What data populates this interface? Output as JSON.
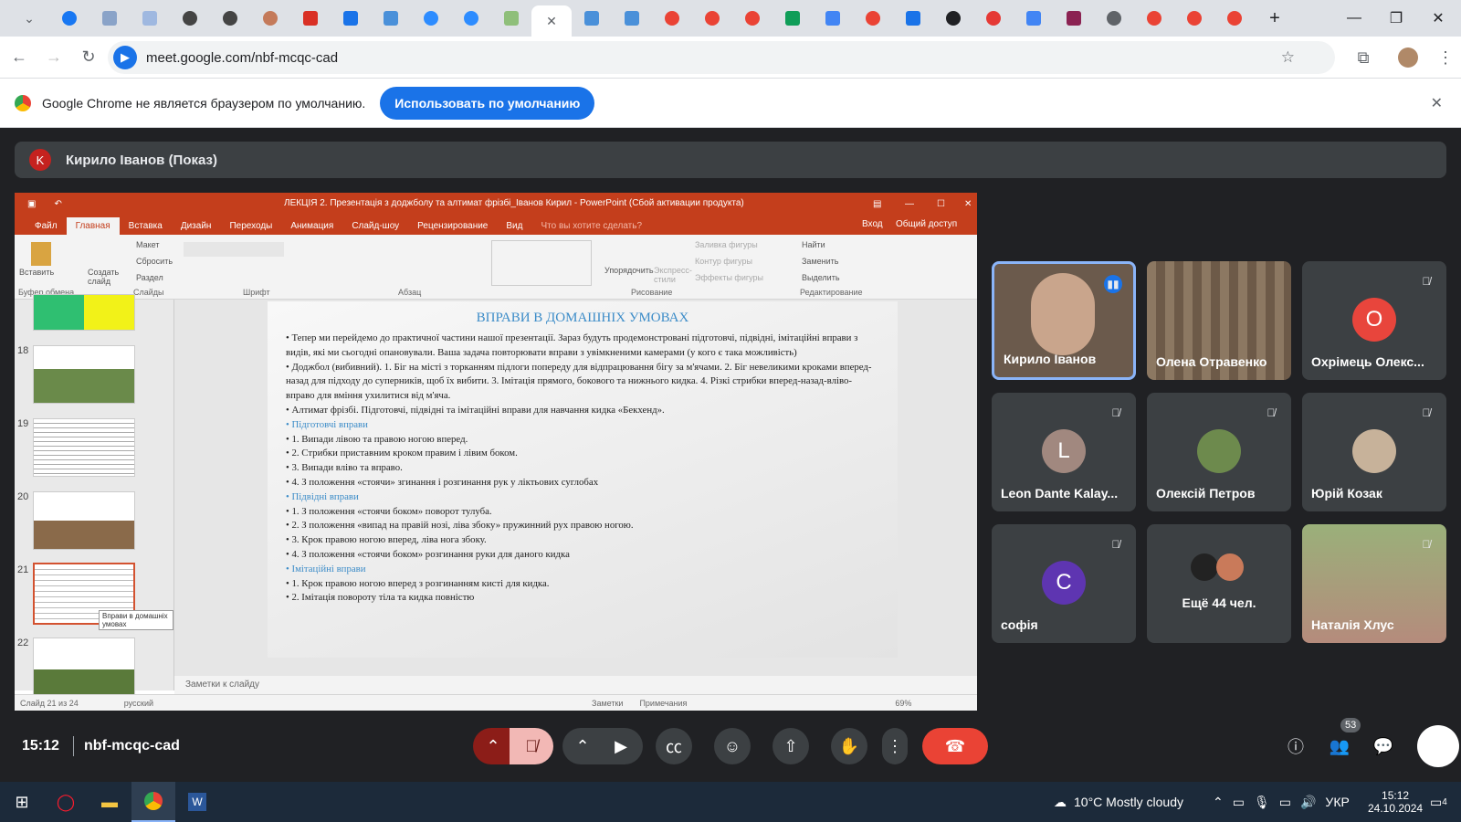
{
  "browser": {
    "tabs": [
      "facebook",
      "tab",
      "tab",
      "tab",
      "tab",
      "tab",
      "shield",
      "S",
      "tab",
      "zoom",
      "zoom",
      "tab",
      "active",
      "tab",
      "tab",
      "google",
      "google",
      "google",
      "tab",
      "translate",
      "google",
      "S",
      "24",
      "tab",
      "doc",
      "tab",
      "tab",
      "google",
      "google",
      "google"
    ],
    "new_tab_icon": "+",
    "url": "meet.google.com/nbf-mcqc-cad"
  },
  "infobar": {
    "message": "Google Chrome не является браузером по умолчанию.",
    "button": "Использовать по умолчанию",
    "close": "✕"
  },
  "presenter": {
    "avatar_letter": "K",
    "label": "Кирило Іванов (Показ)"
  },
  "powerpoint": {
    "title": "ЛЕКЦІЯ 2. Презентація з доджболу та алтимат фрізбі_Іванов Кирил - PowerPoint (Сбой активации продукта)",
    "tabs": [
      "Файл",
      "Главная",
      "Вставка",
      "Дизайн",
      "Переходы",
      "Анимация",
      "Слайд-шоу",
      "Рецензирование",
      "Вид",
      "Что вы хотите сделать?"
    ],
    "signin": "Вход",
    "share": "Общий доступ",
    "groups": [
      "Буфер обмена",
      "Слайды",
      "Шрифт",
      "Абзац",
      "Рисование",
      "Редактирование"
    ],
    "ribbon_buttons": {
      "paste": "Вставить",
      "new_slide": "Создать слайд",
      "layout": "Макет",
      "reset": "Сбросить",
      "section": "Раздел",
      "arrange": "Упорядочить",
      "quick_styles": "Экспресс-стили",
      "shape_fill": "Заливка фигуры",
      "shape_outline": "Контур фигуры",
      "shape_effects": "Эффекты фигуры",
      "find": "Найти",
      "replace": "Заменить",
      "select": "Выделить"
    },
    "thumb_numbers": [
      "18",
      "19",
      "20",
      "21",
      "22"
    ],
    "tooltip": "Вправи в домашніх умовах",
    "slide": {
      "title": "ВПРАВИ В ДОМАШНІХ УМОВАХ",
      "lines": [
        "• Тепер ми перейдемо до практичної частини нашої презентації. Зараз будуть продемонстровані підготовчі, підвідні, імітаційні вправи з видів, які ми сьогодні опановували. Ваша задача повторювати вправи з увімкненими камерами (у кого є така можливість)",
        "• Доджбол (вибивний). 1. Біг на місті з торканням підлоги попереду для відпрацювання бігу за м'ячами. 2. Біг невеликими кроками вперед- назад для підходу до суперників, щоб їх вибити. 3. Імітація прямого, бокового та нижнього кидка. 4. Різкі стрибки вперед-назад-вліво-вправо для вміння ухилитися від м'яча.",
        "• Алтимат фрізбі. Підготовчі, підвідні та імітаційні вправи для навчання кидка «Бекхенд».",
        "• Підготовчі вправи",
        "• 1. Випади лівою та правою ногою вперед.",
        "• 2. Стрибки приставним кроком правим і лівим боком.",
        "• 3. Випади вліво та вправо.",
        "• 4. З положення «стоячи» згинання і розгинання рук у ліктьових суглобах",
        "• Підвідні вправи",
        "• 1. З положення «стоячи боком» поворот тулуба.",
        "• 2. З положення «випад на правій нозі, ліва збоку» пружинний рух правою ногою.",
        "• 3. Крок правою ногою вперед, ліва нога збоку.",
        "• 4. З положення «стоячи боком» розгинання руки для даного кидка",
        "• Імітаційні вправи",
        "• 1. Крок правою ногою вперед з розгинанням кисті для кидка.",
        "• 2. Імітація повороту тіла та кидка повністю"
      ]
    },
    "notes": "Заметки к слайду",
    "status_left": "Слайд 21 из 24",
    "status_lang": "русский",
    "status_notes": "Заметки",
    "status_comments": "Примечания",
    "zoom": "69%"
  },
  "participants": [
    {
      "name": "Кирило Іванов",
      "video": true,
      "speaking": true,
      "color": "#7d6a5a"
    },
    {
      "name": "Олена Отравенко",
      "video": true,
      "speaking": false,
      "color": "#8a7560"
    },
    {
      "name": "Охрімець Олекс...",
      "avatar": "O",
      "color": "#e8453c",
      "muted": true
    },
    {
      "name": "Leon Dante Kalay...",
      "avatar": "L",
      "color": "#a1887f",
      "muted": true
    },
    {
      "name": "Олексій Петров",
      "avatar": "",
      "color": "#6d8a4d",
      "muted": true
    },
    {
      "name": "Юрій Козак",
      "avatar": "",
      "color": "#c7b29a",
      "muted": true
    },
    {
      "name": "софія",
      "avatar": "C",
      "color": "#5e35b1",
      "muted": true
    },
    {
      "name": "Ещё 44 чел.",
      "avatar": "",
      "color": "#555",
      "muted": false
    },
    {
      "name": "Наталія Хлус",
      "video": true,
      "color": "#b58b7c",
      "muted": true
    }
  ],
  "meeting": {
    "time": "15:12",
    "code": "nbf-mcqc-cad",
    "people_count": "53"
  },
  "taskbar": {
    "weather": "10°C  Mostly cloudy",
    "lang": "УКР",
    "time": "15:12",
    "date": "24.10.2024",
    "notif": "4"
  }
}
